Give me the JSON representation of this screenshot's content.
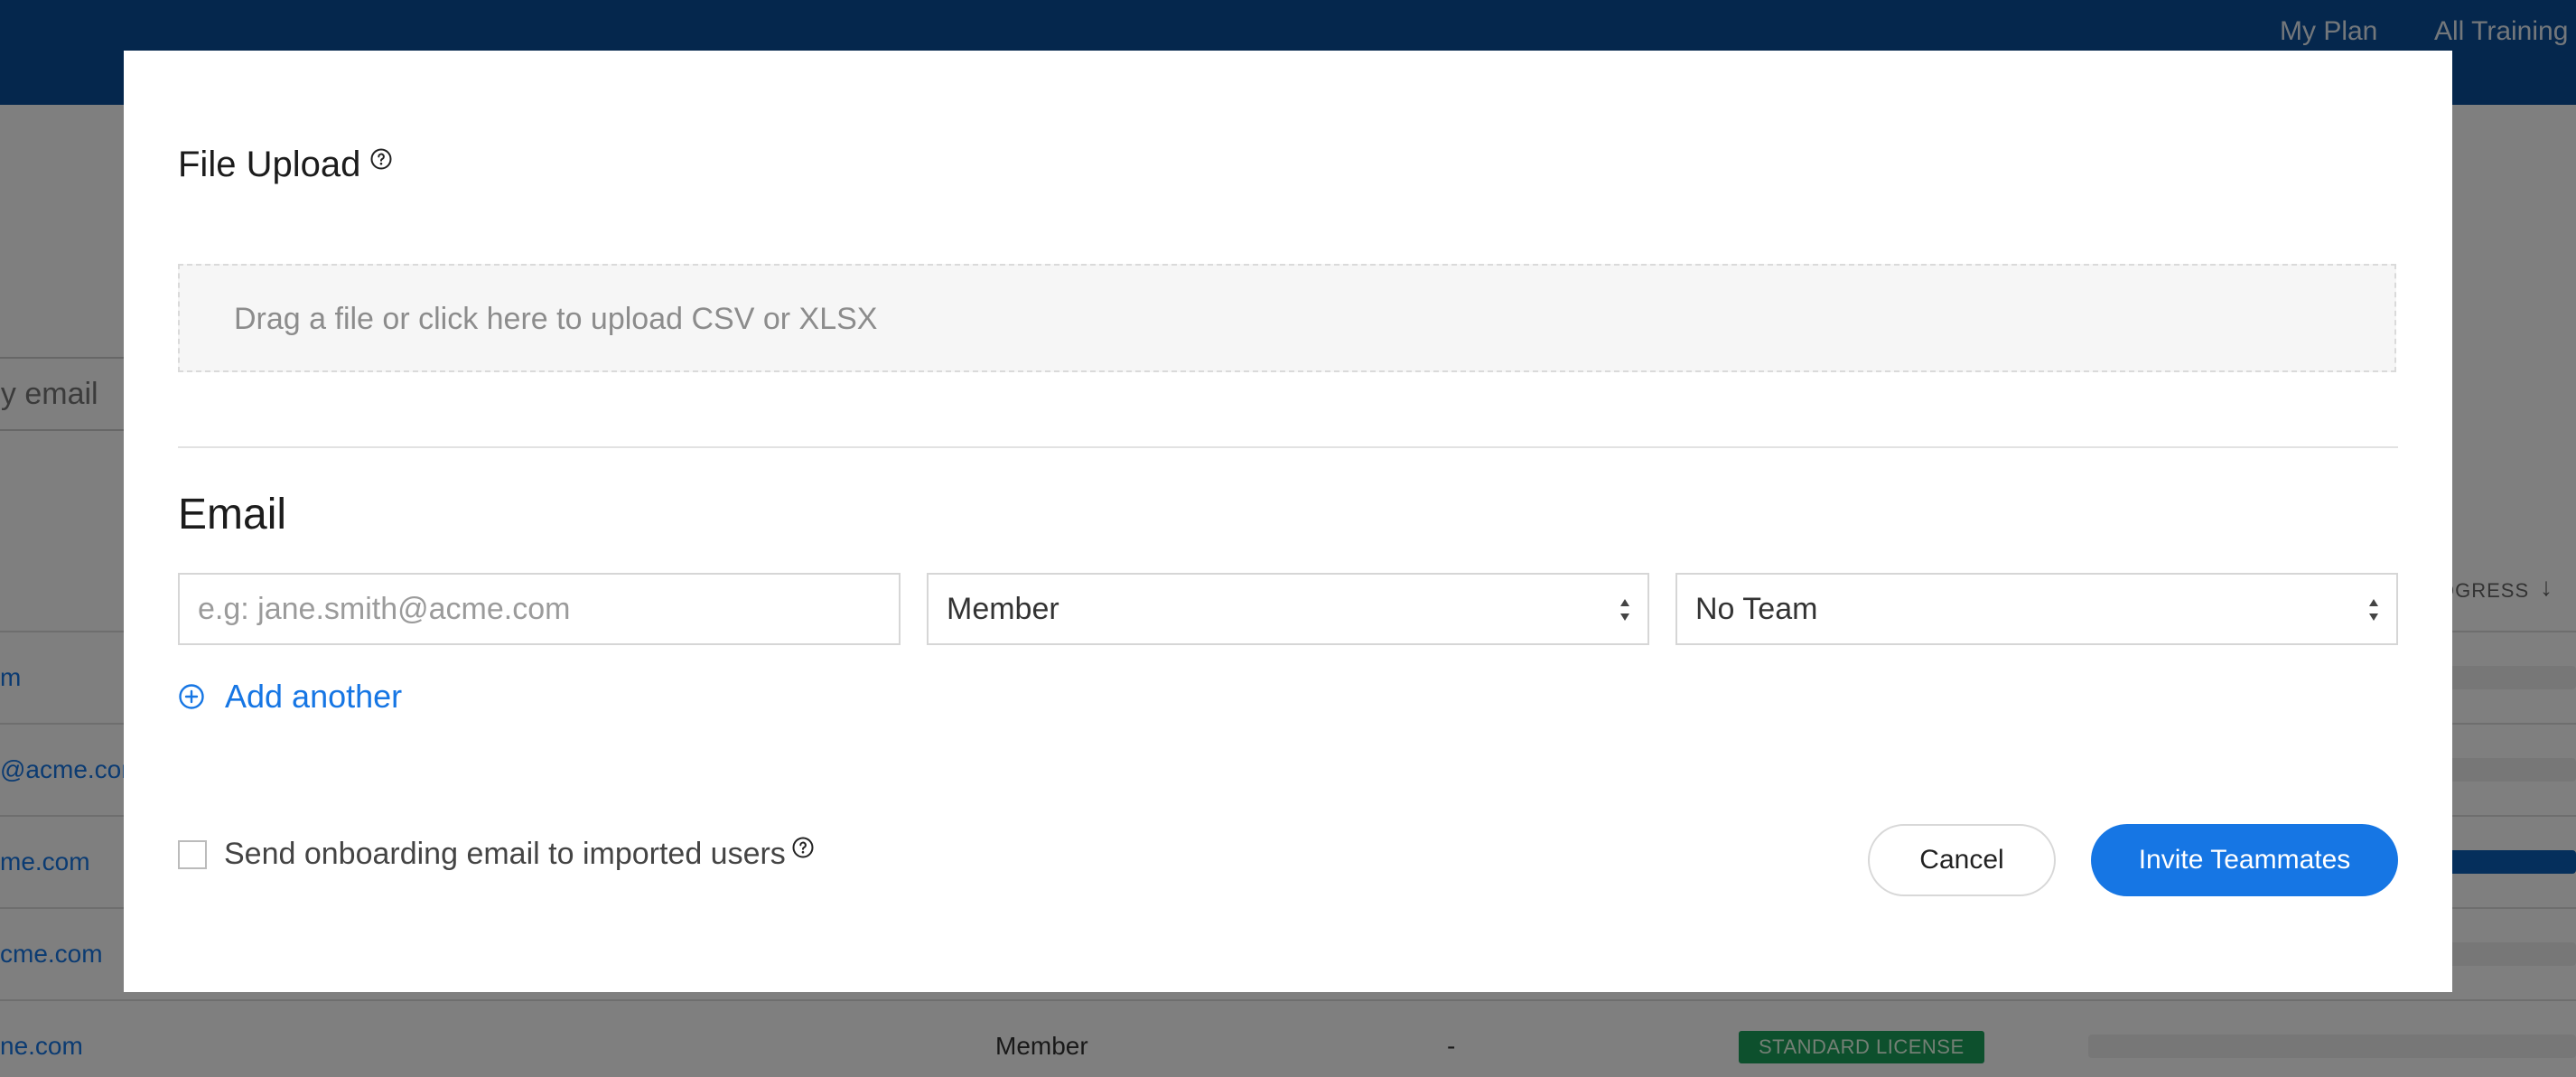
{
  "background": {
    "nav": {
      "my_plan": "My Plan",
      "all_training": "All Training"
    },
    "search_placeholder_partial": "by email",
    "table": {
      "progress_header_partial": "OGRESS",
      "email_fragments": [
        "m",
        "@acme.com",
        "me.com",
        "cme.com",
        "ne.com"
      ],
      "last_row": {
        "role": "Member",
        "team": "-",
        "license": "STANDARD LICENSE"
      },
      "progress_values": [
        0,
        0,
        1,
        0,
        0
      ]
    },
    "colors": {
      "topbar": "#0a4f9a",
      "badge": "#1aa05a"
    }
  },
  "modal": {
    "file_upload": {
      "title": "File Upload",
      "dropzone_text": "Drag a file or click here to upload CSV or XLSX"
    },
    "email_section": {
      "title": "Email",
      "email_placeholder": "e.g: jane.smith@acme.com",
      "email_value": "",
      "role_select": {
        "selected": "Member"
      },
      "team_select": {
        "selected": "No Team"
      },
      "add_another_label": "Add another"
    },
    "onboarding": {
      "checkbox_label": "Send onboarding email to imported users",
      "checked": false
    },
    "buttons": {
      "cancel": "Cancel",
      "invite": "Invite Teammates"
    },
    "colors": {
      "accent": "#1676e4"
    },
    "icons": {
      "help": "question-circle-icon",
      "add": "plus-circle-icon",
      "select_arrows": "sort-arrows-icon"
    }
  }
}
